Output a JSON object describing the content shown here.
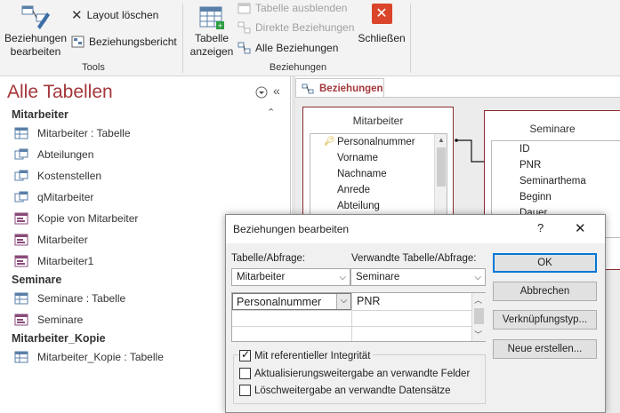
{
  "ribbon": {
    "edit_relationships": "Beziehungen\nbearbeiten",
    "clear_layout": "Layout löschen",
    "relationship_report": "Beziehungsbericht",
    "tools_group": "Tools",
    "show_table": "Tabelle\nanzeigen",
    "hide_table": "Tabelle ausblenden",
    "direct_relationships": "Direkte Beziehungen",
    "all_relationships": "Alle Beziehungen",
    "close": "Schließen",
    "relationships_group": "Beziehungen",
    "colors": {
      "close_red": "#d9442b",
      "disabled": "#a0a0a0"
    }
  },
  "nav": {
    "title": "Alle Tabellen",
    "categories": [
      {
        "name": "Mitarbeiter",
        "items": [
          {
            "label": "Mitarbeiter : Tabelle",
            "icon": "table-icon"
          },
          {
            "label": "Abteilungen",
            "icon": "query-icon"
          },
          {
            "label": "Kostenstellen",
            "icon": "query-icon"
          },
          {
            "label": "qMitarbeiter",
            "icon": "query-icon"
          },
          {
            "label": "Kopie von Mitarbeiter",
            "icon": "form-icon"
          },
          {
            "label": "Mitarbeiter",
            "icon": "form-icon"
          },
          {
            "label": "Mitarbeiter1",
            "icon": "form-icon"
          }
        ]
      },
      {
        "name": "Seminare",
        "items": [
          {
            "label": "Seminare : Tabelle",
            "icon": "table-icon"
          },
          {
            "label": "Seminare",
            "icon": "form-icon"
          }
        ]
      },
      {
        "name": "Mitarbeiter_Kopie",
        "items": [
          {
            "label": "Mitarbeiter_Kopie : Tabelle",
            "icon": "table-icon"
          }
        ]
      }
    ],
    "colors": {
      "title": "#a4373a"
    }
  },
  "doc": {
    "tab_label": "Beziehungen",
    "table1": {
      "title": "Mitarbeiter",
      "fields": [
        "Personalnummer",
        "Vorname",
        "Nachname",
        "Anrede",
        "Abteilung"
      ]
    },
    "table2": {
      "title": "Seminare",
      "fields": [
        "ID",
        "PNR",
        "Seminarthema",
        "Beginn",
        "Dauer"
      ]
    }
  },
  "dialog": {
    "title": "Beziehungen bearbeiten",
    "help": "?",
    "close": "✕",
    "table_label": "Tabelle/Abfrage:",
    "related_label": "Verwandte Tabelle/Abfrage:",
    "table_value": "Mitarbeiter",
    "related_value": "Seminare",
    "field_left": "Personalnummer",
    "field_right": "PNR",
    "buttons": {
      "ok": "OK",
      "cancel": "Abbrechen",
      "join_type": "Verknüpfungstyp...",
      "create_new": "Neue erstellen..."
    },
    "referential_integrity": {
      "label": "Mit referentieller Integrität",
      "checked": true
    },
    "cascade_update": {
      "label": "Aktualisierungsweitergabe an verwandte Felder",
      "checked": false
    },
    "cascade_delete": {
      "label": "Löschweitergabe an verwandte Datensätze",
      "checked": false
    }
  }
}
